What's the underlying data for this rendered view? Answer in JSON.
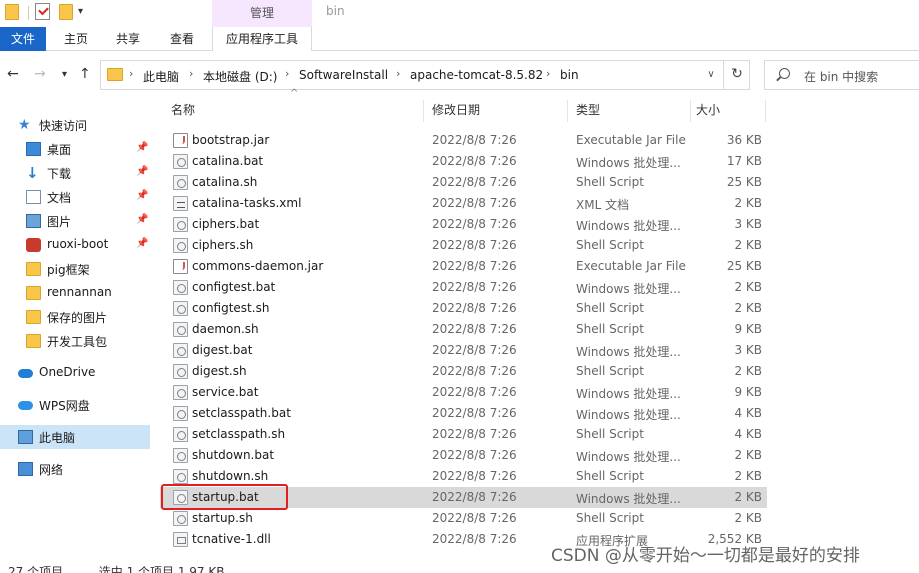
{
  "titlebar": {
    "context_tab": "管理",
    "window_title": "bin"
  },
  "ribbon": {
    "tabs": [
      "文件",
      "主页",
      "共享",
      "查看",
      "应用程序工具"
    ]
  },
  "address": {
    "crumbs": [
      "此电脑",
      "本地磁盘 (D:)",
      "SoftwareInstall",
      "apache-tomcat-8.5.82",
      "bin"
    ],
    "search_placeholder": "在 bin 中搜索"
  },
  "sidebar": {
    "items": [
      {
        "label": "快速访问",
        "icon": "star-icon",
        "pinned": false
      },
      {
        "label": "桌面",
        "icon": "desktop-icon",
        "pinned": true
      },
      {
        "label": "下载",
        "icon": "download-icon",
        "pinned": true
      },
      {
        "label": "文档",
        "icon": "document-icon",
        "pinned": true
      },
      {
        "label": "图片",
        "icon": "picture-icon",
        "pinned": true
      },
      {
        "label": "ruoxi-boot",
        "icon": "app-icon",
        "pinned": true
      },
      {
        "label": "pig框架",
        "icon": "folder-icon",
        "pinned": false
      },
      {
        "label": "rennannan",
        "icon": "folder-icon",
        "pinned": false
      },
      {
        "label": "保存的图片",
        "icon": "folder-icon",
        "pinned": false
      },
      {
        "label": "开发工具包",
        "icon": "folder-icon",
        "pinned": false
      },
      {
        "label": "OneDrive",
        "icon": "cloud-icon",
        "pinned": false
      },
      {
        "label": "WPS网盘",
        "icon": "cloud-icon",
        "pinned": false
      },
      {
        "label": "此电脑",
        "icon": "computer-icon",
        "pinned": false
      },
      {
        "label": "网络",
        "icon": "network-icon",
        "pinned": false
      }
    ]
  },
  "columns": [
    "名称",
    "修改日期",
    "类型",
    "大小"
  ],
  "files": [
    {
      "name": "bootstrap.jar",
      "date": "2022/8/8 7:26",
      "type": "Executable Jar File",
      "size": "36 KB",
      "icon": "jar"
    },
    {
      "name": "catalina.bat",
      "date": "2022/8/8 7:26",
      "type": "Windows 批处理...",
      "size": "17 KB",
      "icon": "gear"
    },
    {
      "name": "catalina.sh",
      "date": "2022/8/8 7:26",
      "type": "Shell Script",
      "size": "25 KB",
      "icon": "gear"
    },
    {
      "name": "catalina-tasks.xml",
      "date": "2022/8/8 7:26",
      "type": "XML 文档",
      "size": "2 KB",
      "icon": "xml"
    },
    {
      "name": "ciphers.bat",
      "date": "2022/8/8 7:26",
      "type": "Windows 批处理...",
      "size": "3 KB",
      "icon": "gear"
    },
    {
      "name": "ciphers.sh",
      "date": "2022/8/8 7:26",
      "type": "Shell Script",
      "size": "2 KB",
      "icon": "gear"
    },
    {
      "name": "commons-daemon.jar",
      "date": "2022/8/8 7:26",
      "type": "Executable Jar File",
      "size": "25 KB",
      "icon": "jar"
    },
    {
      "name": "configtest.bat",
      "date": "2022/8/8 7:26",
      "type": "Windows 批处理...",
      "size": "2 KB",
      "icon": "gear"
    },
    {
      "name": "configtest.sh",
      "date": "2022/8/8 7:26",
      "type": "Shell Script",
      "size": "2 KB",
      "icon": "gear"
    },
    {
      "name": "daemon.sh",
      "date": "2022/8/8 7:26",
      "type": "Shell Script",
      "size": "9 KB",
      "icon": "gear"
    },
    {
      "name": "digest.bat",
      "date": "2022/8/8 7:26",
      "type": "Windows 批处理...",
      "size": "3 KB",
      "icon": "gear"
    },
    {
      "name": "digest.sh",
      "date": "2022/8/8 7:26",
      "type": "Shell Script",
      "size": "2 KB",
      "icon": "gear"
    },
    {
      "name": "service.bat",
      "date": "2022/8/8 7:26",
      "type": "Windows 批处理...",
      "size": "9 KB",
      "icon": "gear"
    },
    {
      "name": "setclasspath.bat",
      "date": "2022/8/8 7:26",
      "type": "Windows 批处理...",
      "size": "4 KB",
      "icon": "gear"
    },
    {
      "name": "setclasspath.sh",
      "date": "2022/8/8 7:26",
      "type": "Shell Script",
      "size": "4 KB",
      "icon": "gear"
    },
    {
      "name": "shutdown.bat",
      "date": "2022/8/8 7:26",
      "type": "Windows 批处理...",
      "size": "2 KB",
      "icon": "gear"
    },
    {
      "name": "shutdown.sh",
      "date": "2022/8/8 7:26",
      "type": "Shell Script",
      "size": "2 KB",
      "icon": "gear"
    },
    {
      "name": "startup.bat",
      "date": "2022/8/8 7:26",
      "type": "Windows 批处理...",
      "size": "2 KB",
      "icon": "gear",
      "selected": true
    },
    {
      "name": "startup.sh",
      "date": "2022/8/8 7:26",
      "type": "Shell Script",
      "size": "2 KB",
      "icon": "gear"
    },
    {
      "name": "tcnative-1.dll",
      "date": "2022/8/8 7:26",
      "type": "应用程序扩展",
      "size": "2,552 KB",
      "icon": "dll"
    }
  ],
  "status": {
    "count": "27 个项目",
    "selected": "选中 1 个项目  1.97 KB"
  },
  "watermark": "CSDN @从零开始～一切都是最好的安排"
}
